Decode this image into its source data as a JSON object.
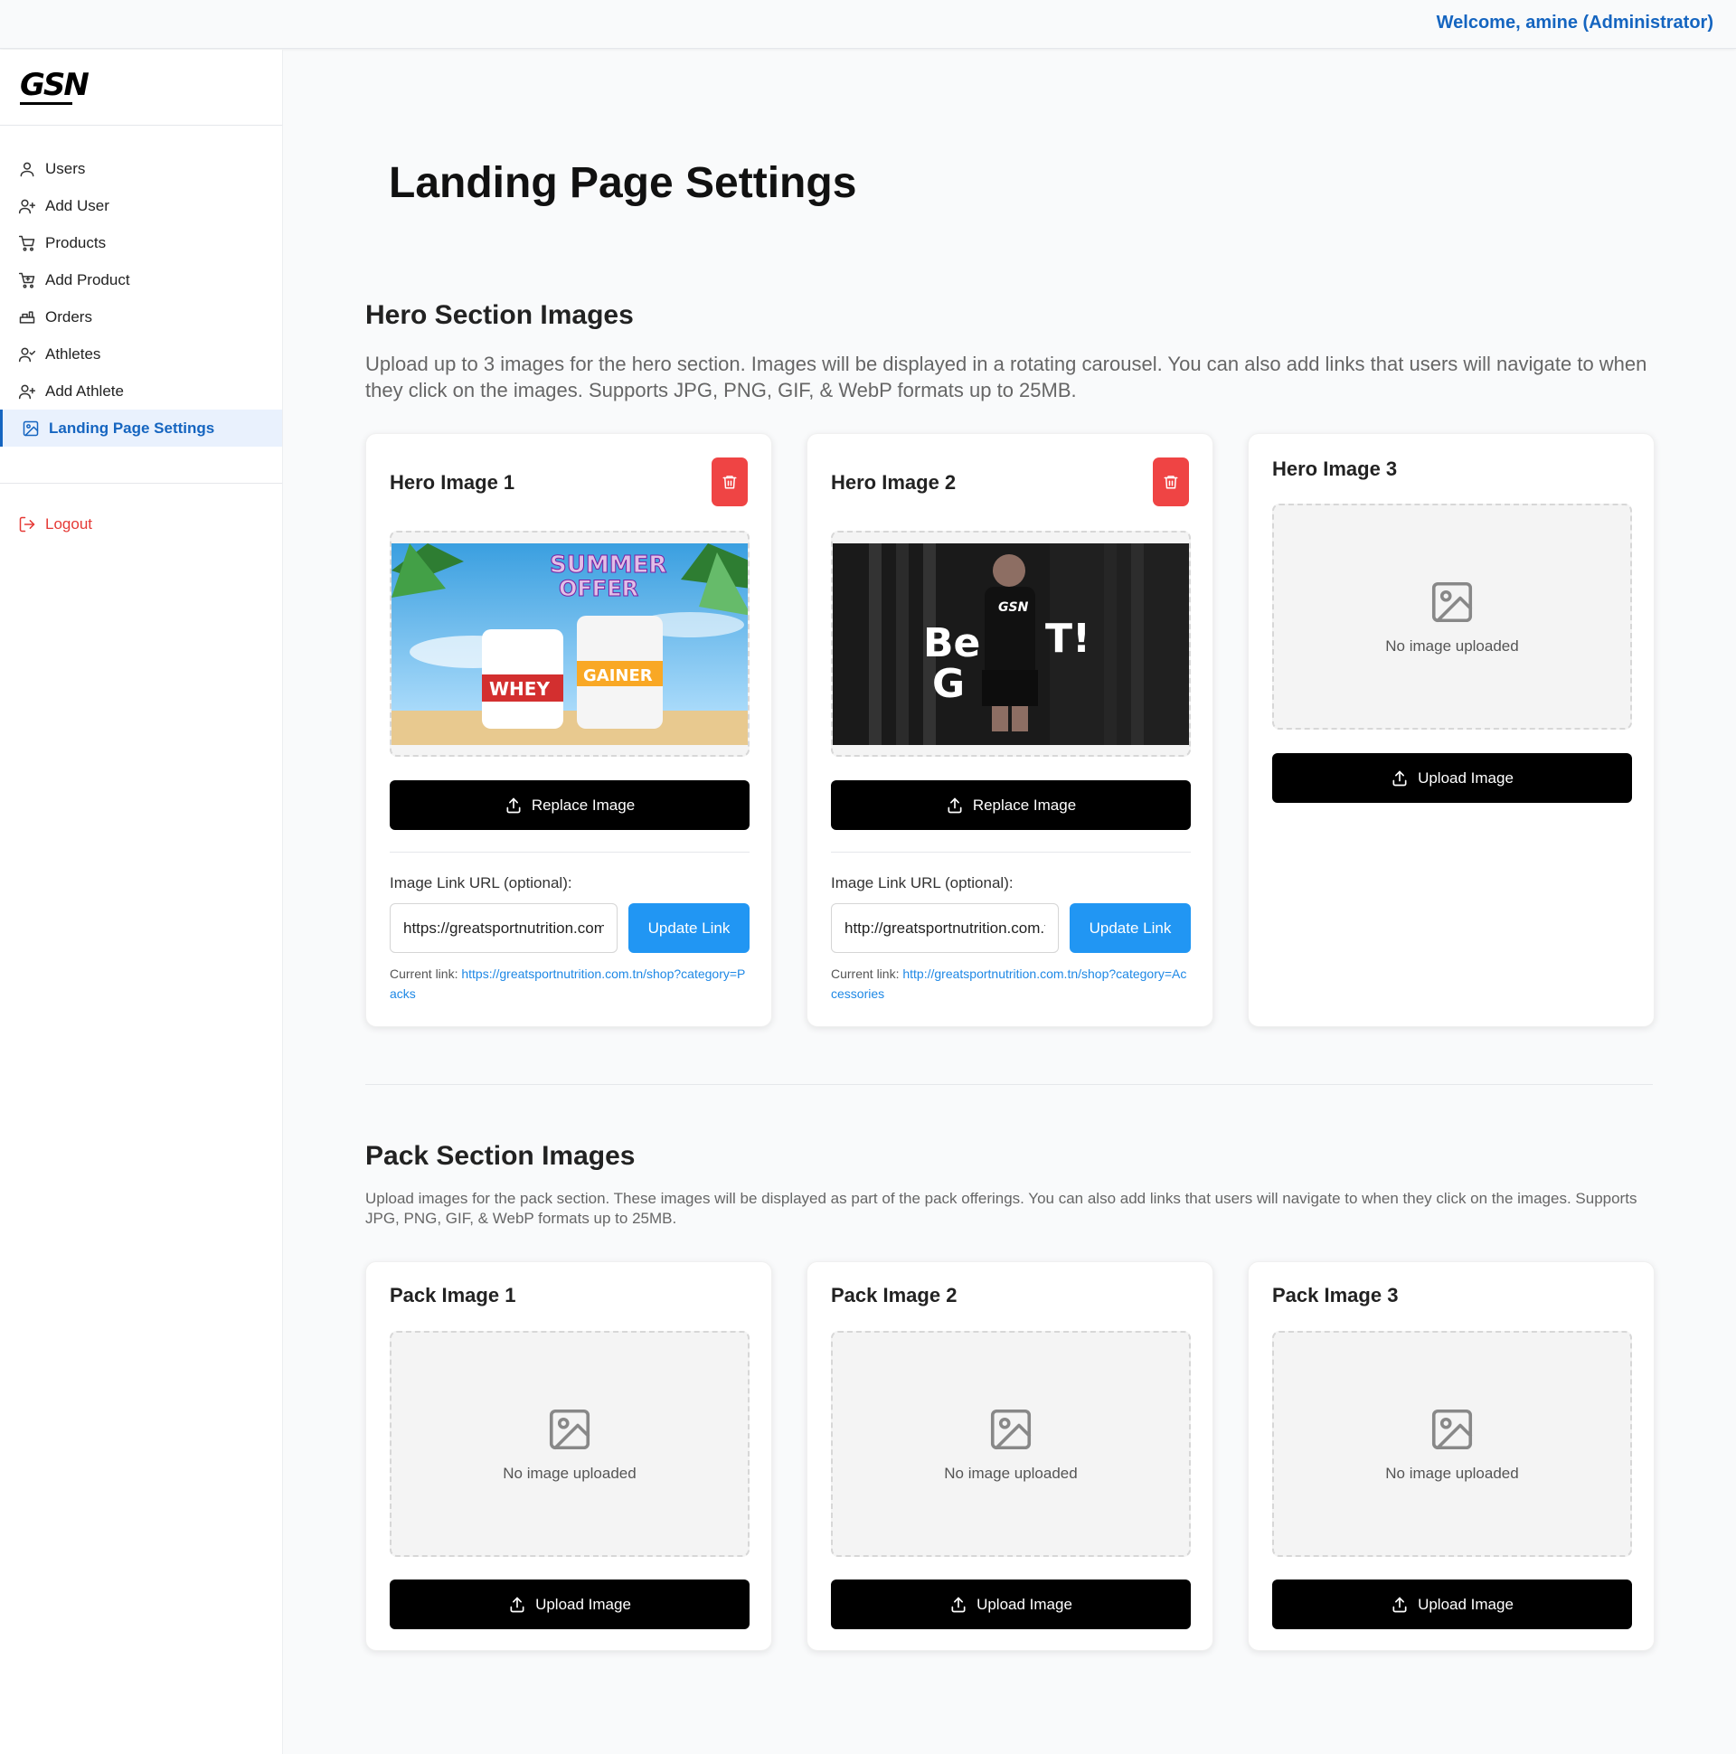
{
  "header": {
    "welcome": "Welcome, amine (Administrator)"
  },
  "brand": {
    "logo": "GSN"
  },
  "sidebar": {
    "items": [
      {
        "label": "Users",
        "icon": "user-icon"
      },
      {
        "label": "Add User",
        "icon": "user-plus-icon"
      },
      {
        "label": "Products",
        "icon": "cart-icon"
      },
      {
        "label": "Add Product",
        "icon": "cart-plus-icon"
      },
      {
        "label": "Orders",
        "icon": "orders-icon"
      },
      {
        "label": "Athletes",
        "icon": "athletes-icon"
      },
      {
        "label": "Add Athlete",
        "icon": "user-plus-icon"
      },
      {
        "label": "Landing Page Settings",
        "icon": "image-icon",
        "active": true
      }
    ],
    "logout": "Logout"
  },
  "page": {
    "title": "Landing Page Settings"
  },
  "hero": {
    "title": "Hero Section Images",
    "description": "Upload up to 3 images for the hero section. Images will be displayed in a rotating carousel. You can also add links that users will navigate to when they click on the images. Supports JPG, PNG, GIF, & WebP formats up to 25MB.",
    "cards": [
      {
        "title": "Hero Image 1",
        "button": "Replace Image",
        "link_label": "Image Link URL (optional):",
        "link_value": "https://greatsportnutrition.com.tn/shop?category=Packs",
        "update_label": "Update Link",
        "current_prefix": "Current link:",
        "current_link": "https://greatsportnutrition.com.tn/shop?category=Packs",
        "image_text": [
          "SUMMER",
          "OFFER",
          "WHEY",
          "GAINER"
        ]
      },
      {
        "title": "Hero Image 2",
        "button": "Replace Image",
        "link_label": "Image Link URL (optional):",
        "link_value": "http://greatsportnutrition.com.tn/shop?category=Accessories",
        "update_label": "Update Link",
        "current_prefix": "Current link:",
        "current_link": "http://greatsportnutrition.com.tn/shop?category=Accessories",
        "image_text": [
          "Be",
          "G",
          "T!",
          "GSN"
        ]
      },
      {
        "title": "Hero Image 3",
        "button": "Upload Image",
        "placeholder": "No image uploaded"
      }
    ]
  },
  "pack": {
    "title": "Pack Section Images",
    "description": "Upload images for the pack section. These images will be displayed as part of the pack offerings. You can also add links that users will navigate to when they click on the images. Supports JPG, PNG, GIF, & WebP formats up to 25MB.",
    "cards": [
      {
        "title": "Pack Image 1",
        "button": "Upload Image",
        "placeholder": "No image uploaded"
      },
      {
        "title": "Pack Image 2",
        "button": "Upload Image",
        "placeholder": "No image uploaded"
      },
      {
        "title": "Pack Image 3",
        "button": "Upload Image",
        "placeholder": "No image uploaded"
      }
    ]
  },
  "colors": {
    "accent": "#1565c0",
    "danger": "#ef4444",
    "primary_button": "#000000",
    "link_button": "#2196f3"
  }
}
